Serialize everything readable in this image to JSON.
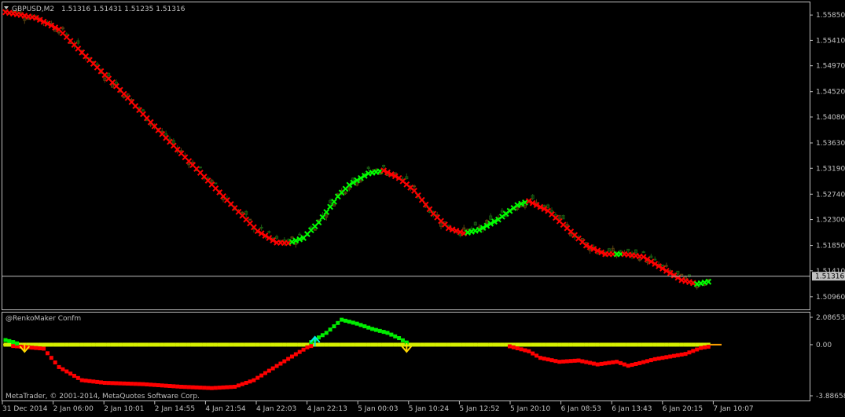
{
  "header": {
    "symbol": "GBPUSD,M2",
    "ohlc": "1.51316 1.51431 1.51235 1.51316"
  },
  "indicator": {
    "title": "@RenkoMaker Confm"
  },
  "copyright": "MetaTrader, © 2001-2014, MetaQuotes Software Corp.",
  "colors": {
    "background": "#000000",
    "frame": "#c0c0c0",
    "text": "#c0c0c0",
    "down_cross": "#ff0000",
    "up_cross": "#00ff00",
    "bull_candle": "#1a5e12",
    "bear_candle": "#5b4310",
    "price_line": "#c0c0c0",
    "sig_low": "#ff0000",
    "sig_high": "#00ee00",
    "zero_line": "#ffa000",
    "dots_yellow": "#d6f000",
    "arrow_up": "#00e6e6",
    "arrow_down": "#ffd700"
  },
  "chart_data": [
    {
      "type": "candlestick",
      "price_axis_ticks": [
        "1.55850",
        "1.55410",
        "1.54970",
        "1.54520",
        "1.54080",
        "1.53630",
        "1.53190",
        "1.52740",
        "1.52300",
        "1.51850",
        "1.51410",
        "1.50960"
      ],
      "ylim": [
        1.5074,
        1.5607
      ],
      "current_price": "1.51316",
      "time_axis_ticks": [
        "31 Dec 2014",
        "2 Jan 06:00",
        "2 Jan 10:01",
        "2 Jan 14:55",
        "4 Jan 21:54",
        "4 Jan 22:03",
        "4 Jan 22:13",
        "5 Jan 00:03",
        "5 Jan 10:24",
        "5 Jan 12:52",
        "5 Jan 20:10",
        "6 Jan 08:53",
        "6 Jan 13:43",
        "6 Jan 20:15",
        "7 Jan 10:07"
      ],
      "cross_series": {
        "key_points": [
          [
            0,
            1.559
          ],
          [
            8,
            1.558
          ],
          [
            14,
            1.556
          ],
          [
            20,
            1.552
          ],
          [
            30,
            1.5455
          ],
          [
            40,
            1.5385
          ],
          [
            50,
            1.5318
          ],
          [
            60,
            1.525
          ],
          [
            66,
            1.521
          ],
          [
            71,
            1.519
          ],
          [
            74,
            1.5189
          ],
          [
            78,
            1.5198
          ],
          [
            82,
            1.5225
          ],
          [
            87,
            1.527
          ],
          [
            90,
            1.529
          ],
          [
            95,
            1.531
          ],
          [
            99,
            1.5315
          ],
          [
            103,
            1.5302
          ],
          [
            107,
            1.528
          ],
          [
            112,
            1.524
          ],
          [
            116,
            1.5215
          ],
          [
            120,
            1.5206
          ],
          [
            124,
            1.5212
          ],
          [
            129,
            1.523
          ],
          [
            134,
            1.5255
          ],
          [
            137,
            1.5262
          ],
          [
            142,
            1.5245
          ],
          [
            147,
            1.5215
          ],
          [
            152,
            1.5185
          ],
          [
            157,
            1.517
          ],
          [
            162,
            1.517
          ],
          [
            167,
            1.5165
          ],
          [
            172,
            1.5145
          ],
          [
            177,
            1.5125
          ],
          [
            181,
            1.5118
          ],
          [
            184,
            1.5122
          ]
        ],
        "up_ranges": [
          [
            75,
            98
          ],
          [
            121,
            136
          ],
          [
            160,
            161
          ],
          [
            181,
            184
          ]
        ]
      }
    },
    {
      "type": "line",
      "name": "@RenkoMaker Confm",
      "yaxis_ticks": [
        "2.08653",
        "0.00",
        "-3.88658"
      ],
      "ylim": [
        -3.88658,
        2.08653
      ],
      "zero_line": 0,
      "count": 185,
      "signal_high_red": [
        [
          0,
          -0.05
        ],
        [
          10,
          -0.3
        ],
        [
          14,
          -1.7
        ],
        [
          20,
          -2.7
        ],
        [
          26,
          -2.9
        ],
        [
          36,
          -3.0
        ],
        [
          46,
          -3.2
        ],
        [
          54,
          -3.3
        ],
        [
          60,
          -3.2
        ],
        [
          65,
          -2.7
        ],
        [
          70,
          -1.8
        ],
        [
          75,
          -0.9
        ],
        [
          79,
          -0.2
        ],
        [
          81,
          0.0
        ],
        [
          125,
          0.0
        ],
        [
          127,
          0.0
        ],
        [
          131,
          -0.05
        ],
        [
          137,
          -0.5
        ],
        [
          140,
          -1.0
        ],
        [
          145,
          -1.3
        ],
        [
          150,
          -1.2
        ],
        [
          155,
          -1.5
        ],
        [
          160,
          -1.3
        ],
        [
          163,
          -1.6
        ],
        [
          166,
          -1.4
        ],
        [
          170,
          -1.1
        ],
        [
          174,
          -0.9
        ],
        [
          178,
          -0.7
        ],
        [
          182,
          -0.25
        ],
        [
          184,
          -0.15
        ]
      ],
      "signal_green": [
        [
          80,
          0.2
        ],
        [
          84,
          0.9
        ],
        [
          88,
          1.9
        ],
        [
          92,
          1.6
        ],
        [
          96,
          1.2
        ],
        [
          100,
          0.9
        ],
        [
          103,
          0.5
        ],
        [
          106,
          0.0
        ]
      ],
      "left_green": [
        [
          0,
          0.35
        ],
        [
          2,
          0.2
        ],
        [
          4,
          0.0
        ]
      ],
      "arrows_up": [
        81
      ],
      "arrows_down": [
        5,
        105
      ]
    }
  ]
}
